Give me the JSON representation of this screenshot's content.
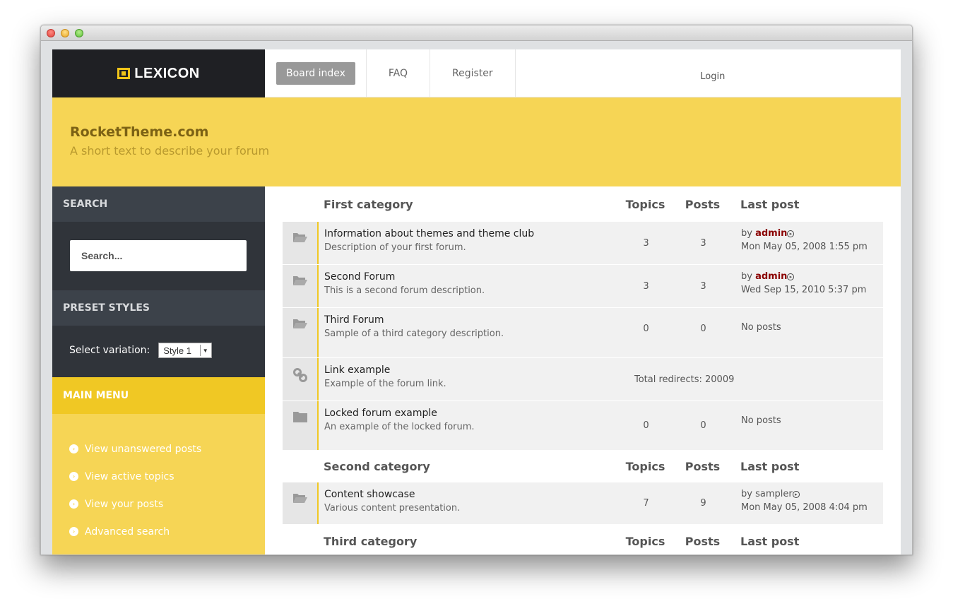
{
  "logo": {
    "text": "LEXICON"
  },
  "nav": {
    "items": [
      {
        "label": "Board index"
      },
      {
        "label": "FAQ"
      },
      {
        "label": "Register"
      },
      {
        "label": "Login"
      }
    ]
  },
  "banner": {
    "title": "RocketTheme.com",
    "description": "A short text to describe your forum"
  },
  "sidebar": {
    "search_heading": "SEARCH",
    "search_placeholder": "Search...",
    "preset_heading": "PRESET STYLES",
    "preset_label": "Select variation:",
    "preset_value": "Style 1",
    "menu_heading": "MAIN MENU",
    "menu_items": [
      {
        "label": "View unanswered posts"
      },
      {
        "label": "View active topics"
      },
      {
        "label": "View your posts"
      },
      {
        "label": "Advanced search"
      }
    ]
  },
  "columns": {
    "topics": "Topics",
    "posts": "Posts",
    "last_post": "Last post"
  },
  "categories": [
    {
      "name": "First category",
      "forums": [
        {
          "title": "Information about themes and theme club",
          "desc": "Description of your first forum.",
          "topics": "3",
          "posts": "3",
          "by": "by",
          "author": "admin",
          "date": "Mon May 05, 2008 1:55 pm"
        },
        {
          "title": "Second Forum",
          "desc": "This is a second forum description.",
          "topics": "3",
          "posts": "3",
          "by": "by",
          "author": "admin",
          "date": "Wed Sep 15, 2010 5:37 pm"
        },
        {
          "title": "Third Forum",
          "desc": "Sample of a third category description.",
          "topics": "0",
          "posts": "0",
          "no_posts": "No posts"
        },
        {
          "title": "Link example",
          "desc": "Example of the forum link.",
          "redirects": "Total redirects: 20009"
        },
        {
          "title": "Locked forum example",
          "desc": "An example of the locked forum.",
          "topics": "0",
          "posts": "0",
          "no_posts": "No posts"
        }
      ]
    },
    {
      "name": "Second category",
      "forums": [
        {
          "title": "Content showcase",
          "desc": "Various content presentation.",
          "topics": "7",
          "posts": "9",
          "by": "by",
          "author": "sampler",
          "date": "Mon May 05, 2008 4:04 pm"
        }
      ]
    },
    {
      "name": "Third category"
    }
  ],
  "icons": {
    "forum": "folder-open-icon",
    "link": "link-icon",
    "locked": "folder-closed-icon",
    "menu": "chevron-circle-icon",
    "goto": "goto-post-icon"
  }
}
